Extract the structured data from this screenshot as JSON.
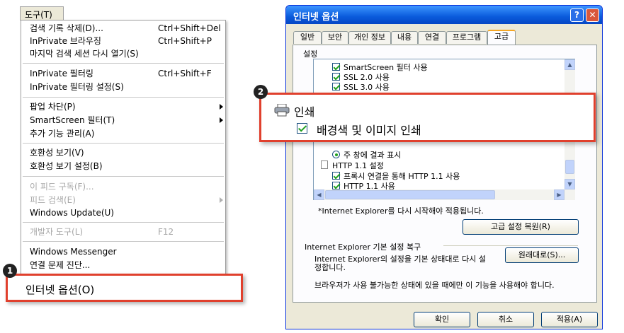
{
  "tools_menu": {
    "title": "도구(T)",
    "items": [
      {
        "label": "검색 기록 삭제(D)...",
        "shortcut": "Ctrl+Shift+Del",
        "enabled": true
      },
      {
        "label": "InPrivate 브라우징",
        "shortcut": "Ctrl+Shift+P",
        "enabled": true
      },
      {
        "label": "마지막 검색 세션 다시 열기(S)",
        "shortcut": "",
        "enabled": true
      },
      {
        "label": "InPrivate 필터링",
        "shortcut": "Ctrl+Shift+F",
        "enabled": true
      },
      {
        "label": "InPrivate 필터링 설정(S)",
        "shortcut": "",
        "enabled": true
      },
      {
        "label": "팝업 차단(P)",
        "shortcut": "",
        "enabled": true,
        "submenu": true
      },
      {
        "label": "SmartScreen 필터(T)",
        "shortcut": "",
        "enabled": true,
        "submenu": true
      },
      {
        "label": "추가 기능 관리(A)",
        "shortcut": "",
        "enabled": true
      },
      {
        "label": "호환성 보기(V)",
        "shortcut": "",
        "enabled": true
      },
      {
        "label": "호환성 보기 설정(B)",
        "shortcut": "",
        "enabled": true
      },
      {
        "label": "이 피드 구독(F)...",
        "shortcut": "",
        "enabled": false
      },
      {
        "label": "피드 검색(E)",
        "shortcut": "",
        "enabled": false,
        "submenu": true
      },
      {
        "label": "Windows Update(U)",
        "shortcut": "",
        "enabled": true
      },
      {
        "label": "개발자 도구(L)",
        "shortcut": "F12",
        "enabled": false
      },
      {
        "label": "Windows Messenger",
        "shortcut": "",
        "enabled": true
      },
      {
        "label": "연결 문제 진단...",
        "shortcut": "",
        "enabled": true
      }
    ],
    "highlighted_item": "인터넷 옵션(O)"
  },
  "badges": {
    "step1": "1",
    "step2": "2"
  },
  "dialog": {
    "title": "인터넷 옵션",
    "help_button": "?",
    "close_button": "✕",
    "tabs": [
      "일반",
      "보안",
      "개인 정보",
      "내용",
      "연결",
      "프로그램",
      "고급"
    ],
    "active_tab": "고급",
    "settings_label": "설정",
    "tree_items_top": [
      "SmartScreen 필터 사용",
      "SSL 2.0 사용",
      "SSL 3.0 사용"
    ],
    "tree_items_bottom": [
      {
        "type": "radio",
        "label": "주 창에 결과 표시"
      },
      {
        "type": "folder",
        "label": "HTTP 1.1 설정"
      },
      {
        "type": "check",
        "label": "프록시 연결을 통해 HTTP 1.1 사용"
      },
      {
        "type": "check",
        "label": "HTTP 1.1 사용"
      }
    ],
    "restart_note": "*Internet Explorer를 다시 시작해야 적용됩니다.",
    "restore_advanced_button": "고급 설정 복원(R)",
    "reset_group_label": "Internet Explorer 기본 설정 복구",
    "reset_description_1": "Internet Explorer의 설정을 기본 상태대로 다시 설",
    "reset_description_2": "정합니다.",
    "reset_button": "원래대로(S)...",
    "reset_warning": "브라우저가 사용 불가능한 상태에 있을 때에만 이 기능을 사용해야 합니다.",
    "ok_button": "확인",
    "cancel_button": "취소",
    "apply_button": "적용(A)"
  },
  "zoom_callout": {
    "group_label": "인쇄",
    "check_label": "배경색 및 이미지 인쇄",
    "printer_icon": "printer-icon"
  },
  "colors": {
    "highlight_border": "#e0402d",
    "titlebar": "#0a5bdc",
    "check": "#21a121"
  }
}
